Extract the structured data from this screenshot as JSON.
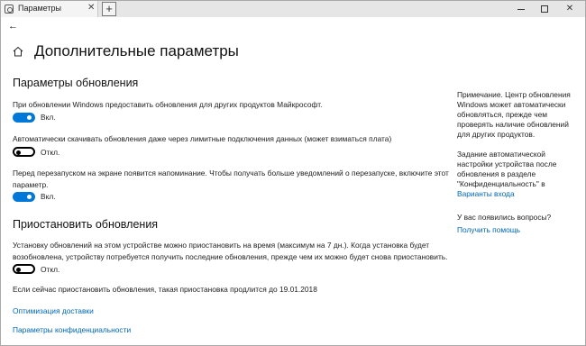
{
  "window": {
    "tab_title": "Параметры",
    "tab_close_icon": "close-icon",
    "new_tab_icon": "plus-icon",
    "new_tab_glyph": "+",
    "controls": [
      "minimize-icon",
      "maximize-icon",
      "close-icon"
    ],
    "close_glyph": "✕",
    "tab_close_glyph": "✕"
  },
  "nav": {
    "back_glyph": "←",
    "home_icon": "home-icon"
  },
  "page": {
    "title": "Дополнительные параметры"
  },
  "updates": {
    "title": "Параметры обновления",
    "option1": {
      "text": "При обновлении Windows предоставить обновления для других продуктов Майкрософт.",
      "state": "Вкл.",
      "on": true
    },
    "option2": {
      "text": "Автоматически скачивать обновления даже через лимитные подключения данных (может взиматься плата)",
      "state": "Откл.",
      "on": false
    },
    "option3": {
      "text_line1": "Перед перезапуском на экране появится напоминание. Чтобы получать больше уведомлений о перезапуске, включите этот",
      "text_line2": "параметр.",
      "state": "Вкл.",
      "on": true
    }
  },
  "pause": {
    "title": "Приостановить обновления",
    "text_line1": "Установку обновлений на этом устройстве можно приостановить на время (максимум на 7 дн.). Когда установка будет",
    "text_line2": "возобновлена, устройству потребуется получить последние обновления, прежде чем их можно будет снова приостановить.",
    "state": "Откл.",
    "on": false,
    "note": "Если сейчас приостановить обновления, такая приостановка продлится до 19.01.2018"
  },
  "links": {
    "delivery": "Оптимизация доставки",
    "privacy": "Параметры конфиденциальности"
  },
  "sidebar": {
    "note_lines": [
      "Примечание. Центр обновления",
      "Windows может автоматически",
      "обновляться, прежде чем",
      "проверять наличие обновлений",
      "для других продуктов."
    ],
    "task_lines": [
      "Задание автоматической",
      "настройки устройства после",
      "обновления в разделе",
      "\"Конфиденциальность\" в"
    ],
    "task_link": "Варианты входа",
    "question": "У вас появились вопросы?",
    "help_link": "Получить помощь"
  }
}
